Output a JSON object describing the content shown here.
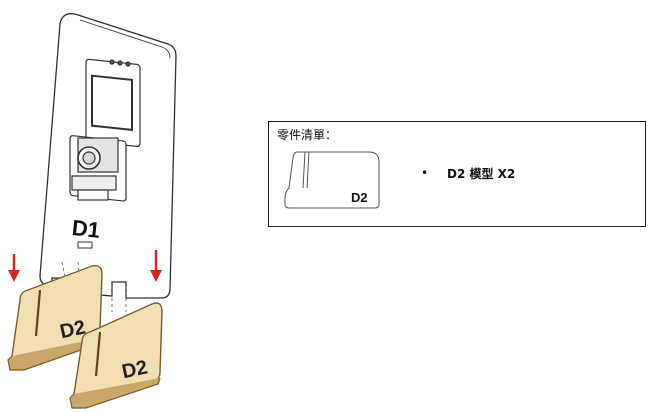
{
  "illustration": {
    "board_label": "D1",
    "stand_left_label": "D2",
    "stand_right_label": "D2",
    "arrow_color": "#d9261c",
    "wood_color": "#f1dfb3",
    "wood_edge_color": "#9a7b4f"
  },
  "parts_list": {
    "title": "零件清單：",
    "icon_label": "D2",
    "bullet": "•",
    "item_text": "D2 模型 X2"
  }
}
